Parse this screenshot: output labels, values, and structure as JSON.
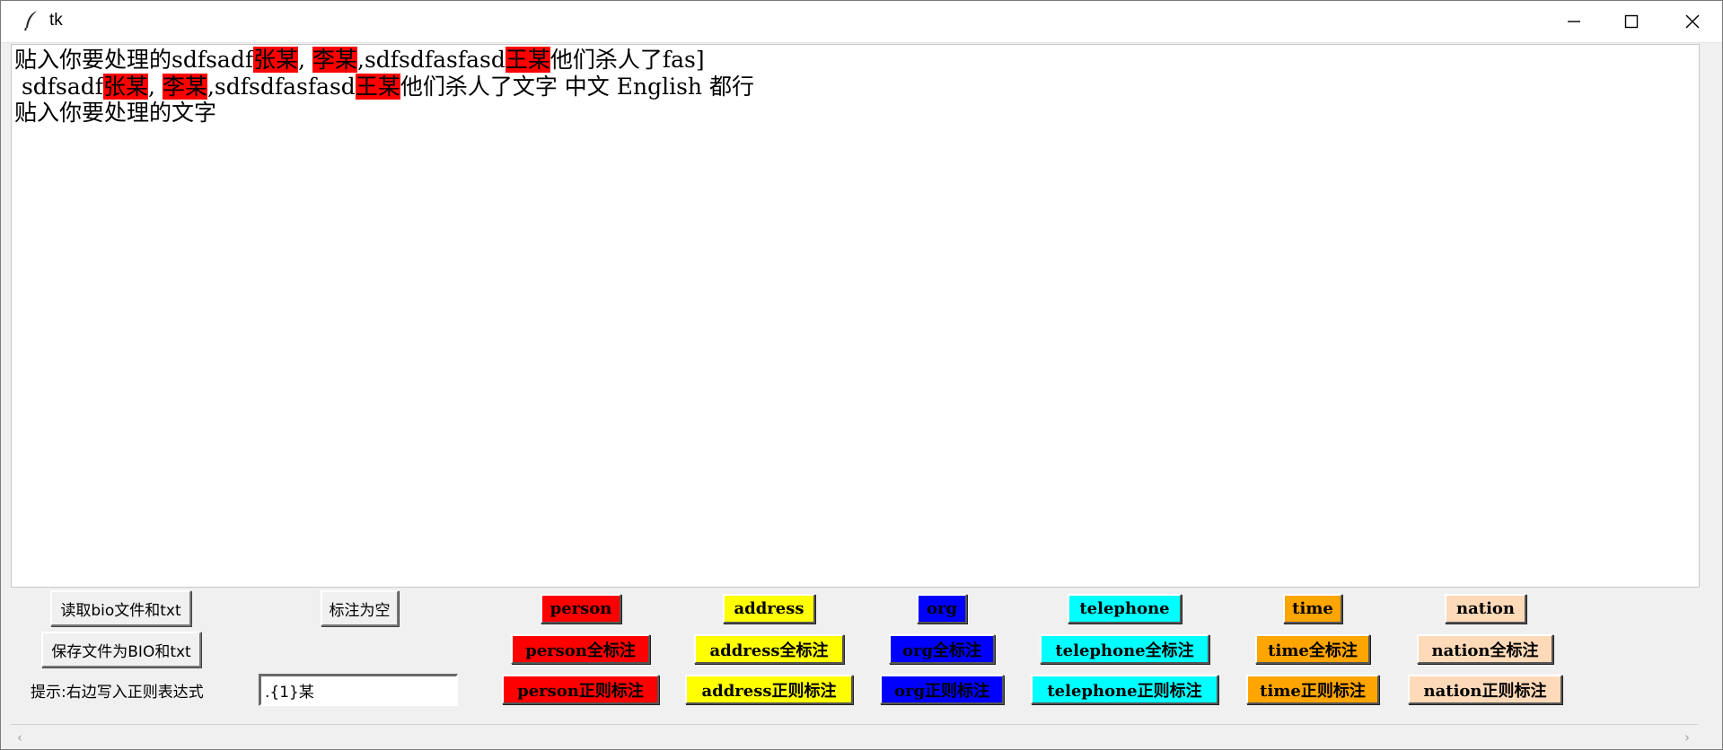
{
  "window": {
    "title": "tk",
    "icons": {
      "app": "feather-icon",
      "minimize": "minimize-icon",
      "maximize": "maximize-icon",
      "close": "close-icon"
    }
  },
  "text": {
    "lines": [
      [
        {
          "t": "贴入你要处理的sdfsadf",
          "hl": false
        },
        {
          "t": "张某",
          "hl": true
        },
        {
          "t": ", ",
          "hl": false
        },
        {
          "t": "李某",
          "hl": true
        },
        {
          "t": ",sdfsdfasfasd",
          "hl": false
        },
        {
          "t": "王某",
          "hl": true
        },
        {
          "t": "他们杀人了fas]",
          "hl": false
        }
      ],
      [
        {
          "t": " sdfsadf",
          "hl": false
        },
        {
          "t": "张某",
          "hl": true
        },
        {
          "t": ", ",
          "hl": false
        },
        {
          "t": "李某",
          "hl": true
        },
        {
          "t": ",sdfsdfasfasd",
          "hl": false
        },
        {
          "t": "王某",
          "hl": true
        },
        {
          "t": "他们杀人了文字 中文 English 都行",
          "hl": false
        }
      ],
      [
        {
          "t": "贴入你要处理的文字",
          "hl": false
        }
      ]
    ],
    "highlight_color": "#ff0000"
  },
  "controls": {
    "read_button": "读取bio文件和txt",
    "clear_button": "标注为空",
    "save_button": "保存文件为BIO和txt",
    "hint": "提示:右边写入正则表达式",
    "regex_value": ".{1}某"
  },
  "tags": [
    {
      "key": "person",
      "label": "person",
      "all": "person全标注",
      "regex": "person正则标注",
      "color": "#ff0000"
    },
    {
      "key": "address",
      "label": "address",
      "all": "address全标注",
      "regex": "address正则标注",
      "color": "#ffff00"
    },
    {
      "key": "org",
      "label": "org",
      "all": "org全标注",
      "regex": "org正则标注",
      "color": "#0000ff"
    },
    {
      "key": "telephone",
      "label": "telephone",
      "all": "telephone全标注",
      "regex": "telephone正则标注",
      "color": "#00ffff"
    },
    {
      "key": "time",
      "label": "time",
      "all": "time全标注",
      "regex": "time正则标注",
      "color": "#ffa500"
    },
    {
      "key": "nation",
      "label": "nation",
      "all": "nation全标注",
      "regex": "nation正则标注",
      "color": "#ffdab9"
    }
  ],
  "scrollbar": {
    "left_arrow": "‹",
    "right_arrow": "›"
  }
}
